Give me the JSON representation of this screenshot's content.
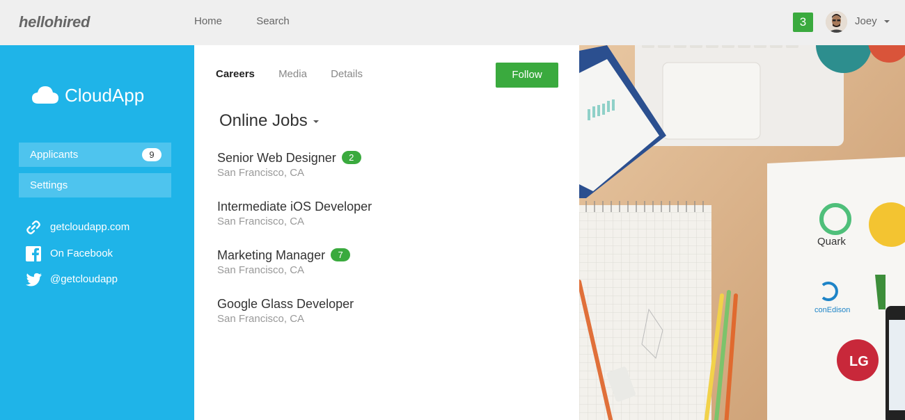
{
  "header": {
    "logo": "hellohired",
    "nav": [
      "Home",
      "Search"
    ],
    "notification_count": "3",
    "user_name": "Joey"
  },
  "sidebar": {
    "brand": "CloudApp",
    "menu": [
      {
        "label": "Applicants",
        "count": "9"
      },
      {
        "label": "Settings"
      }
    ],
    "links": [
      {
        "label": "getcloudapp.com",
        "icon": "link-icon"
      },
      {
        "label": "On Facebook",
        "icon": "facebook-icon"
      },
      {
        "label": "@getcloudapp",
        "icon": "twitter-icon"
      }
    ]
  },
  "main": {
    "tabs": [
      "Careers",
      "Media",
      "Details"
    ],
    "follow_label": "Follow",
    "jobs_title": "Online Jobs",
    "jobs": [
      {
        "title": "Senior Web Designer",
        "location": "San Francisco, CA",
        "count": "2"
      },
      {
        "title": "Intermediate iOS Developer",
        "location": "San Francisco, CA"
      },
      {
        "title": "Marketing Manager",
        "location": "San Francisco, CA",
        "count": "7"
      },
      {
        "title": "Google Glass Developer",
        "location": "San Francisco, CA"
      }
    ]
  },
  "photo": {
    "logo_labels": [
      "Quark",
      "conEdison"
    ]
  },
  "colors": {
    "sidebar": "#1fb4e8",
    "accent_green": "#3aaa3e",
    "topbar": "#efefef"
  }
}
